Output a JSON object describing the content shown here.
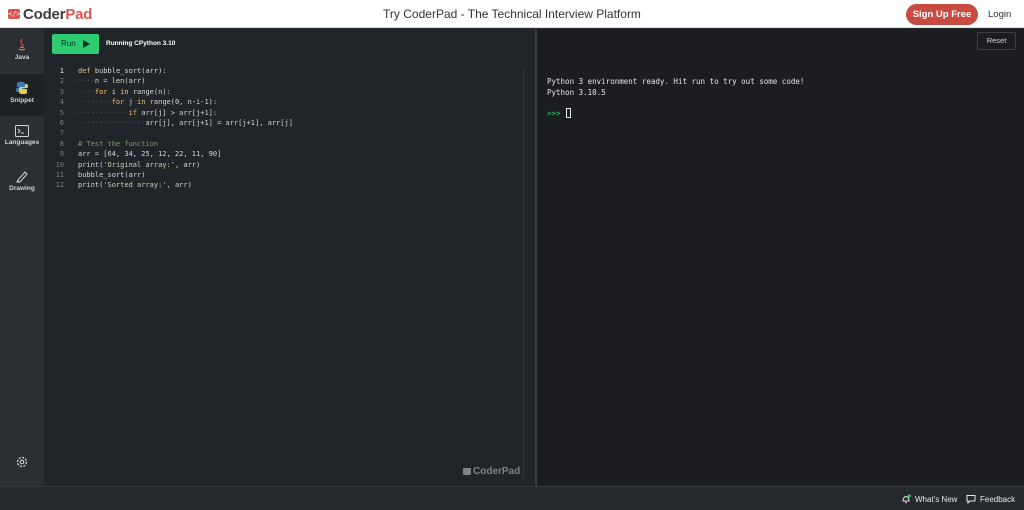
{
  "header": {
    "logo_icon_text": "</>",
    "logo_text_a": "Coder",
    "logo_text_b": "Pad",
    "title": "Try CoderPad - The Technical Interview Platform",
    "signup_label": "Sign Up Free",
    "login_label": "Login"
  },
  "sidebar": {
    "items": [
      {
        "label": "Java",
        "icon": "java-icon"
      },
      {
        "label": "Snippet",
        "icon": "python-icon"
      },
      {
        "label": "Languages",
        "icon": "terminal-icon"
      },
      {
        "label": "Drawing",
        "icon": "pencil-icon"
      }
    ],
    "settings_icon": "gear-icon"
  },
  "editor": {
    "run_label": "Run",
    "status": "Running CPython 3.10",
    "watermark": "CoderPad",
    "lines": [
      {
        "n": "1",
        "text": "def bubble_sort(arr):"
      },
      {
        "n": "2",
        "text": "    n = len(arr)"
      },
      {
        "n": "3",
        "text": "    for i in range(n):"
      },
      {
        "n": "4",
        "text": "        for j in range(0, n-i-1):"
      },
      {
        "n": "5",
        "text": "            if arr[j] > arr[j+1]:"
      },
      {
        "n": "6",
        "text": "                arr[j], arr[j+1] = arr[j+1], arr[j]"
      },
      {
        "n": "7",
        "text": ""
      },
      {
        "n": "8",
        "text": "# Test the function"
      },
      {
        "n": "9",
        "text": "arr = [64, 34, 25, 12, 22, 11, 90]"
      },
      {
        "n": "10",
        "text": "print('Original array:', arr)"
      },
      {
        "n": "11",
        "text": "bubble_sort(arr)"
      },
      {
        "n": "12",
        "text": "print('Sorted array:', arr)"
      }
    ]
  },
  "console": {
    "reset_label": "Reset",
    "output_line1": "Python 3 environment ready. Hit run to try out some code!",
    "output_line2": "Python 3.10.5",
    "prompt": ">>>"
  },
  "footer": {
    "whats_new_label": "What's New",
    "feedback_label": "Feedback"
  },
  "colors": {
    "run_green": "#2ecc71",
    "brand_red": "#c94a40",
    "keyword": "#f0c674",
    "comment": "#7c9a6e"
  }
}
